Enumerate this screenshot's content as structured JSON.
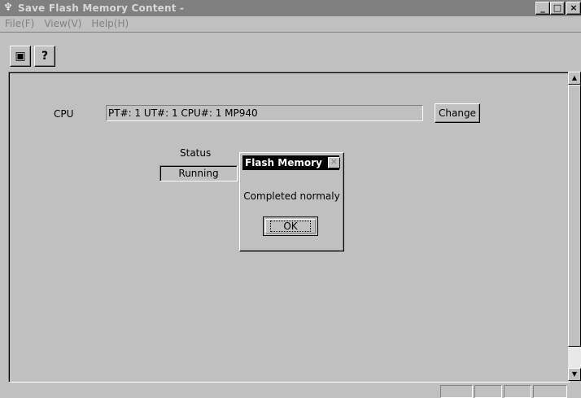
{
  "window": {
    "title": "Save Flash Memory Content -"
  },
  "menu": {
    "items": [
      "File(F)",
      "View(V)",
      "Help(H)"
    ]
  },
  "toolbar": {
    "icons": [
      "save-flash-icon",
      "help-icon"
    ]
  },
  "cpu": {
    "label": "CPU",
    "value": "PT#: 1 UT#: 1 CPU#: 1   MP940",
    "change_label": "Change"
  },
  "status": {
    "label": "Status",
    "value": "Running"
  },
  "dialog": {
    "title": "Flash Memory",
    "message": "Completed normaly",
    "ok_label": "OK"
  }
}
